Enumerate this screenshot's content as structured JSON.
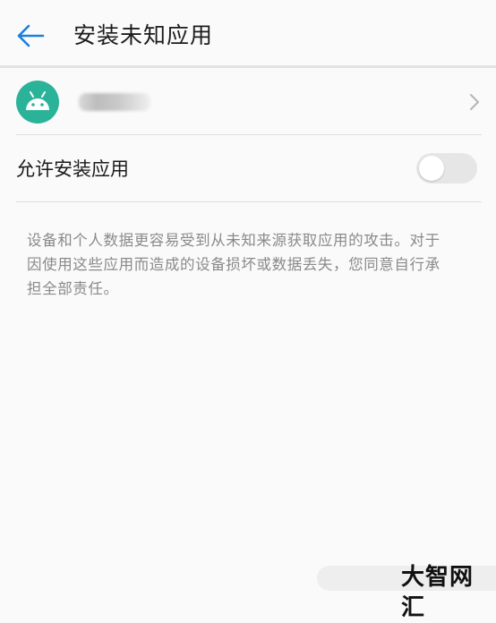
{
  "header": {
    "back_icon": "arrow-left-icon",
    "title": "安装未知应用",
    "accent_color": "#1a7fe0"
  },
  "app": {
    "icon": "android-icon",
    "icon_bg": "#2bb39a",
    "name_redacted": true,
    "chevron_icon": "chevron-right-icon"
  },
  "allow_install": {
    "label": "允许安装应用",
    "enabled": false
  },
  "warning_text": "设备和个人数据更容易受到从未知来源获取应用的攻击。对于因使用这些应用而造成的设备损坏或数据丢失，您同意自行承担全部责任。",
  "watermark": "大智网汇"
}
